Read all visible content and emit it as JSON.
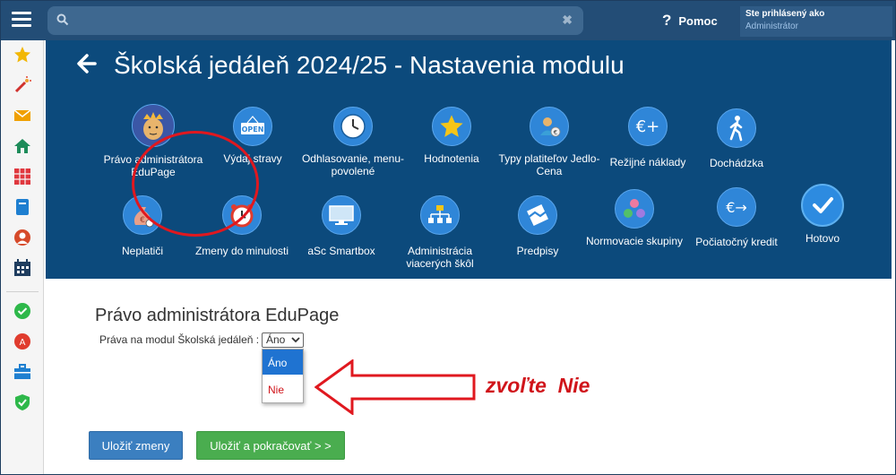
{
  "topbar": {
    "search_placeholder": "",
    "help_label": "Pomoc",
    "user_line1": "Ste prihlásený ako",
    "user_line2": "Administrátor"
  },
  "sidebar": {
    "items": [
      "star-icon",
      "magic-wand-icon",
      "mail-icon",
      "home-icon",
      "timetable-icon",
      "book-icon",
      "person-icon",
      "calendar-icon",
      "check-icon",
      "error-icon",
      "briefcase-icon",
      "shield-icon"
    ]
  },
  "panel": {
    "title": "Školská jedáleň 2024/25 - Nastavenia modulu",
    "modules_row1": [
      {
        "label": "Právo administrátora EduPage",
        "icon": "crown-face-icon"
      },
      {
        "label": "Výdaj stravy",
        "icon": "open-sign-icon"
      },
      {
        "label": "Odhlasovanie, menu-povolené",
        "icon": "clock-icon"
      },
      {
        "label": "Hodnotenia",
        "icon": "star-icon"
      },
      {
        "label": "Typy platiteľov Jedlo-Cena",
        "icon": "payer-icon"
      },
      {
        "label": "Režijné náklady",
        "icon": "euro-plus-icon"
      },
      {
        "label": "Dochádzka",
        "icon": "walking-person-icon"
      }
    ],
    "modules_row2": [
      {
        "label": "Neplatiči",
        "icon": "money-bag-icon"
      },
      {
        "label": "Zmeny do minulosti",
        "icon": "alarm-clock-icon"
      },
      {
        "label": "aSc Smartbox",
        "icon": "monitor-icon"
      },
      {
        "label": "Administrácia viacerých škôl",
        "icon": "hierarchy-icon"
      },
      {
        "label": "Predpisy",
        "icon": "handshake-icon"
      },
      {
        "label": "Normovacie skupiny",
        "icon": "groups-icon"
      },
      {
        "label": "Počiatočný kredit",
        "icon": "euro-arrow-icon"
      },
      {
        "label": "Hotovo",
        "icon": "checkmark-icon"
      }
    ]
  },
  "content": {
    "section_title": "Právo administrátora EduPage",
    "rights_label": "Práva na modul Školská jedáleň :",
    "select_value": "Áno",
    "options": [
      "Áno",
      "Nie"
    ],
    "hint_text": "zvoľte  Nie",
    "save_label": "Uložiť zmeny",
    "save_continue_label": "Uložiť a pokračovať > >"
  },
  "colors": {
    "topbar": "#234d76",
    "panel": "#0c4a7c",
    "icon_circle": "#2f86d8",
    "annotation_red": "#d0141a",
    "save_blue": "#3b7fc0",
    "save_continue_green": "#4aad4f"
  }
}
